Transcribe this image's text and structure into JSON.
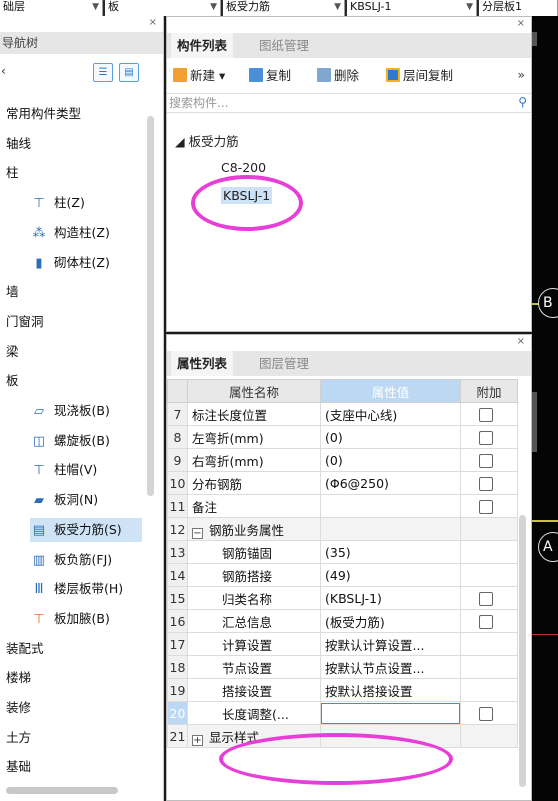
{
  "topbar": {
    "combos": [
      "础层",
      "板",
      "板受力筋",
      "KBSLJ-1",
      "分层板1"
    ]
  },
  "left_panel": {
    "title": "导航树",
    "items": [
      {
        "label": "常用构件类型",
        "icon": "",
        "sub": false
      },
      {
        "label": "轴线",
        "icon": "",
        "sub": false
      },
      {
        "label": "柱",
        "icon": "",
        "sub": false
      },
      {
        "label": "柱(Z)",
        "icon": "column-icon",
        "sub": true
      },
      {
        "label": "构造柱(Z)",
        "icon": "construction-column-icon",
        "sub": true
      },
      {
        "label": "砌体柱(Z)",
        "icon": "masonry-column-icon",
        "sub": true
      },
      {
        "label": "墙",
        "icon": "",
        "sub": false
      },
      {
        "label": "门窗洞",
        "icon": "",
        "sub": false
      },
      {
        "label": "梁",
        "icon": "",
        "sub": false
      },
      {
        "label": "板",
        "icon": "",
        "sub": false
      },
      {
        "label": "现浇板(B)",
        "icon": "cast-slab-icon",
        "sub": true
      },
      {
        "label": "螺旋板(B)",
        "icon": "spiral-slab-icon",
        "sub": true
      },
      {
        "label": "柱帽(V)",
        "icon": "column-cap-icon",
        "sub": true
      },
      {
        "label": "板洞(N)",
        "icon": "slab-hole-icon",
        "sub": true
      },
      {
        "label": "板受力筋(S)",
        "icon": "slab-rebar-icon",
        "sub": true,
        "selected": true
      },
      {
        "label": "板负筋(FJ)",
        "icon": "negative-rebar-icon",
        "sub": true
      },
      {
        "label": "楼层板带(H)",
        "icon": "slab-strip-icon",
        "sub": true
      },
      {
        "label": "板加腋(B)",
        "icon": "slab-haunch-icon",
        "sub": true
      },
      {
        "label": "装配式",
        "icon": "",
        "sub": false
      },
      {
        "label": "楼梯",
        "icon": "",
        "sub": false
      },
      {
        "label": "装修",
        "icon": "",
        "sub": false
      },
      {
        "label": "土方",
        "icon": "",
        "sub": false
      },
      {
        "label": "基础",
        "icon": "",
        "sub": false
      }
    ]
  },
  "component_panel": {
    "tabs": [
      "构件列表",
      "图纸管理"
    ],
    "toolbar": {
      "new_label": "新建",
      "copy_label": "复制",
      "delete_label": "删除",
      "floor_copy_label": "层间复制"
    },
    "search_placeholder": "搜索构件...",
    "tree": {
      "root": "板受力筋",
      "children": [
        "C8-200",
        "KBSLJ-1"
      ],
      "selected": "KBSLJ-1"
    }
  },
  "property_panel": {
    "tabs": [
      "属性列表",
      "图层管理"
    ],
    "headers": {
      "name": "属性名称",
      "value": "属性值",
      "extra": "附加"
    },
    "rows": [
      {
        "num": "7",
        "name": "标注长度位置",
        "value": "(支座中心线)",
        "check": true,
        "indent": 0
      },
      {
        "num": "8",
        "name": "左弯折(mm)",
        "value": "(0)",
        "check": true,
        "indent": 0
      },
      {
        "num": "9",
        "name": "右弯折(mm)",
        "value": "(0)",
        "check": true,
        "indent": 0
      },
      {
        "num": "10",
        "name": "分布钢筋",
        "value": "(Φ6@250)",
        "check": true,
        "indent": 0
      },
      {
        "num": "11",
        "name": "备注",
        "value": "",
        "check": true,
        "indent": 0
      },
      {
        "num": "12",
        "name": "钢筋业务属性",
        "value": "",
        "check": false,
        "indent": 0,
        "group": true,
        "toggle": "−"
      },
      {
        "num": "13",
        "name": "钢筋锚固",
        "value": "(35)",
        "check": false,
        "indent": 1
      },
      {
        "num": "14",
        "name": "钢筋搭接",
        "value": "(49)",
        "check": false,
        "indent": 1
      },
      {
        "num": "15",
        "name": "归类名称",
        "value": "(KBSLJ-1)",
        "check": true,
        "indent": 1
      },
      {
        "num": "16",
        "name": "汇总信息",
        "value": "(板受力筋)",
        "check": true,
        "indent": 1
      },
      {
        "num": "17",
        "name": "计算设置",
        "value": "按默认计算设置...",
        "check": false,
        "indent": 1
      },
      {
        "num": "18",
        "name": "节点设置",
        "value": "按默认节点设置...",
        "check": false,
        "indent": 1
      },
      {
        "num": "19",
        "name": "搭接设置",
        "value": "按默认搭接设置",
        "check": false,
        "indent": 1
      },
      {
        "num": "20",
        "name": "长度调整(...",
        "value": "",
        "check": true,
        "indent": 1,
        "editing": true
      },
      {
        "num": "21",
        "name": "显示样式",
        "value": "",
        "check": false,
        "indent": 0,
        "group": true,
        "toggle": "+"
      }
    ]
  },
  "canvas": {
    "axis_labels": [
      "B",
      "A"
    ],
    "line_color": "#c9c23a"
  },
  "colors": {
    "annotation": "#e83ed8",
    "accent": "#2a78c8",
    "header_highlight": "#bcd8f2"
  }
}
